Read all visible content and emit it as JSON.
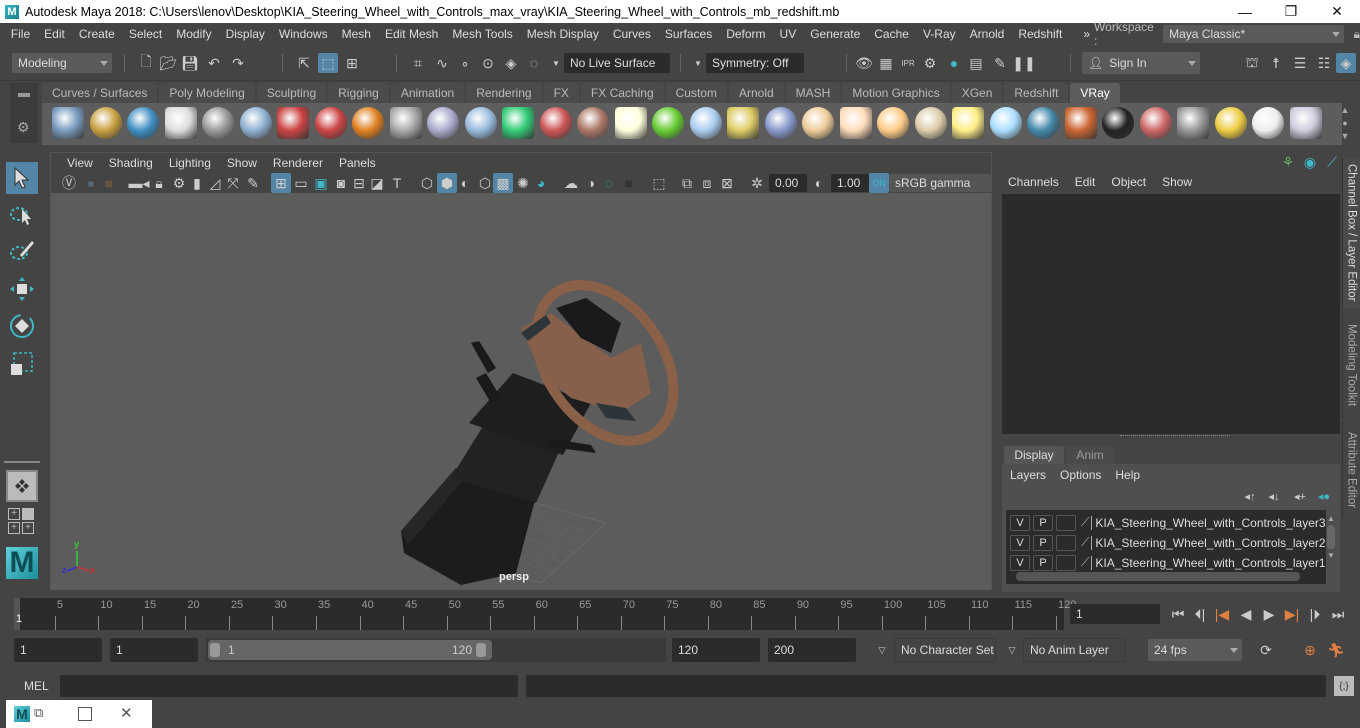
{
  "window": {
    "title": "Autodesk Maya 2018: C:\\Users\\lenov\\Desktop\\KIA_Steering_Wheel_with_Controls_max_vray\\KIA_Steering_Wheel_with_Controls_mb_redshift.mb",
    "minimize": "—",
    "maximize": "❐",
    "close": "✕"
  },
  "menubar": {
    "items": [
      "File",
      "Edit",
      "Create",
      "Select",
      "Modify",
      "Display",
      "Windows",
      "Mesh",
      "Edit Mesh",
      "Mesh Tools",
      "Mesh Display",
      "Curves",
      "Surfaces",
      "Deform",
      "UV",
      "Generate",
      "Cache",
      "V-Ray",
      "Arnold",
      "Redshift"
    ],
    "overflow": "»",
    "workspace_label": "Workspace :",
    "workspace_value": "Maya Classic*"
  },
  "statusline": {
    "mode": "Modeling",
    "live_surface": "No Live Surface",
    "symmetry": "Symmetry: Off",
    "sign_in": "Sign In"
  },
  "shelf": {
    "tabs": [
      "Curves / Surfaces",
      "Poly Modeling",
      "Sculpting",
      "Rigging",
      "Animation",
      "Rendering",
      "FX",
      "FX Caching",
      "Custom",
      "Arnold",
      "MASH",
      "Motion Graphics",
      "XGen",
      "Redshift",
      "VRay"
    ],
    "active_tab": "VRay",
    "icons": [
      "save-scene-icon",
      "open-scene-icon",
      "list-icon",
      "vray-logo-icon",
      "vray-doc-icon",
      "vray-sphere-light-icon",
      "vray-camera-icon",
      "vray-material-icon",
      "vray-fire-icon",
      "vray-proxy-icon",
      "vray-box-icon",
      "vray-cone-icon",
      "vray-ies-icon",
      "vray-mtl-icon",
      "vray-texture-icon",
      "vray-dome-light-icon",
      "vray-fur-icon",
      "vray-instancer-icon",
      "vray-curve-icon",
      "vray-sphere-icon",
      "vray-half-dome-icon",
      "vray-spot-icon",
      "vray-orb-icon",
      "vray-cone-light-icon",
      "vray-sun-icon",
      "vray-plane-icon",
      "vray-blue-sphere-icon",
      "vray-flag-sphere-icon",
      "vray-checker-icon",
      "vray-frame-buffer-icon",
      "vray-settings-icon",
      "vray-light-list-icon",
      "vray-cloud-icon",
      "help-icon"
    ]
  },
  "viewport": {
    "menu": [
      "View",
      "Shading",
      "Lighting",
      "Show",
      "Renderer",
      "Panels"
    ],
    "exposure": "0.00",
    "gamma": "1.00",
    "color_space": "sRGB gamma",
    "camera_label": "persp",
    "axis": {
      "x": "x",
      "y": "y",
      "z": "z"
    }
  },
  "channel_box": {
    "menu": [
      "Channels",
      "Edit",
      "Object",
      "Show"
    ]
  },
  "layer_editor": {
    "tabs": [
      "Display",
      "Anim"
    ],
    "active_tab": "Display",
    "menu": [
      "Layers",
      "Options",
      "Help"
    ],
    "layers": [
      {
        "v": "V",
        "p": "P",
        "name": "KIA_Steering_Wheel_with_Controls_layer3"
      },
      {
        "v": "V",
        "p": "P",
        "name": "KIA_Steering_Wheel_with_Controls_layer2"
      },
      {
        "v": "V",
        "p": "P",
        "name": "KIA_Steering_Wheel_with_Controls_layer1"
      }
    ]
  },
  "side_tabs": [
    "Channel Box / Layer Editor",
    "Modeling Toolkit",
    "Attribute Editor"
  ],
  "timeline": {
    "ticks": [
      "5",
      "10",
      "15",
      "20",
      "25",
      "30",
      "35",
      "40",
      "45",
      "50",
      "55",
      "60",
      "65",
      "70",
      "75",
      "80",
      "85",
      "90",
      "95",
      "100",
      "105",
      "110",
      "115",
      "120"
    ],
    "current_frame_marker": "1",
    "current_frame": "1"
  },
  "range": {
    "start": "1",
    "current": "1",
    "slider_start": "1",
    "slider_end": "120",
    "end": "120",
    "anim_end": "200",
    "character_set": "No Character Set",
    "anim_layer": "No Anim Layer",
    "fps": "24 fps"
  },
  "cmdline": {
    "label": "MEL"
  },
  "colors": {
    "accent": "#5285a6",
    "keyframe": "#e08040",
    "wheel": "#8a6048"
  }
}
